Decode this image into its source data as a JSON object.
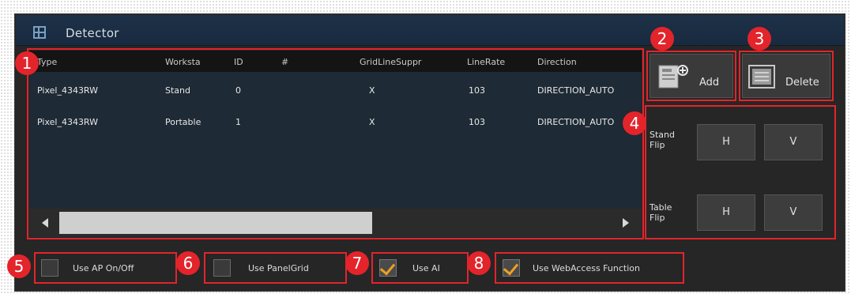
{
  "window": {
    "title": "Detector",
    "icon": "grid-icon"
  },
  "annotations": [
    "1",
    "2",
    "3",
    "4",
    "5",
    "6",
    "7",
    "8"
  ],
  "table": {
    "columns": [
      "Type",
      "Worksta",
      "ID",
      "#",
      "GridLineSuppr",
      "LineRate",
      "Direction"
    ],
    "rows": [
      [
        "Pixel_4343RW",
        "Stand",
        "0",
        "",
        "X",
        "103",
        "DIRECTION_AUTO"
      ],
      [
        "Pixel_4343RW",
        "Portable",
        "1",
        "",
        "X",
        "103",
        "DIRECTION_AUTO"
      ]
    ]
  },
  "buttons": {
    "add": "Add",
    "delete": "Delete",
    "add_icon": "add-detector-icon",
    "delete_icon": "delete-detector-icon"
  },
  "flip": {
    "stand_label": "Stand\nFlip",
    "table_label": "Table\nFlip",
    "h": "H",
    "v": "V"
  },
  "options": [
    {
      "label": "Use AP On/Off",
      "checked": false
    },
    {
      "label": "Use PanelGrid",
      "checked": false
    },
    {
      "label": "Use AI",
      "checked": true
    },
    {
      "label": "Use WebAccess Function",
      "checked": true
    }
  ],
  "colors": {
    "annotation": "#e3242b",
    "check": "#f0a020",
    "titlebar": "#1d3148"
  }
}
